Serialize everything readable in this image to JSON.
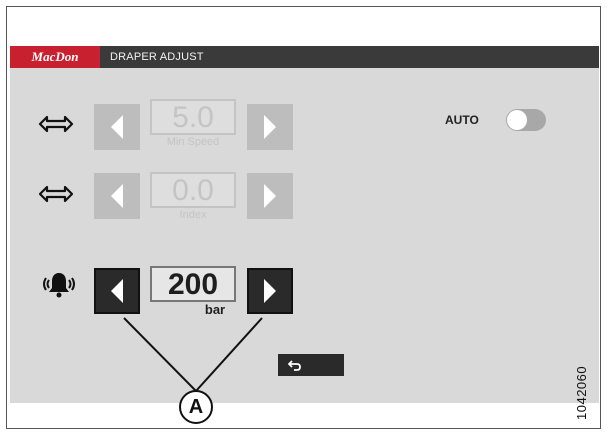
{
  "header": {
    "brand": "MacDon",
    "title": "DRAPER ADJUST"
  },
  "rows": [
    {
      "icon": "double-arrow-icon",
      "value": "5.0",
      "label": "Min Speed",
      "enabled": false
    },
    {
      "icon": "double-arrow-icon",
      "value": "0.0",
      "label": "Index",
      "enabled": false
    },
    {
      "icon": "bell-icon",
      "value": "200",
      "label": "bar",
      "enabled": true
    }
  ],
  "auto": {
    "label": "AUTO",
    "state": "off"
  },
  "back_button": {
    "icon": "back-arrow-icon"
  },
  "callout": {
    "label": "A"
  },
  "figure_id": "1042060",
  "colors": {
    "brand": "#c8202f",
    "titlebar": "#3a3a3a",
    "screen": "#d9d9d9"
  }
}
